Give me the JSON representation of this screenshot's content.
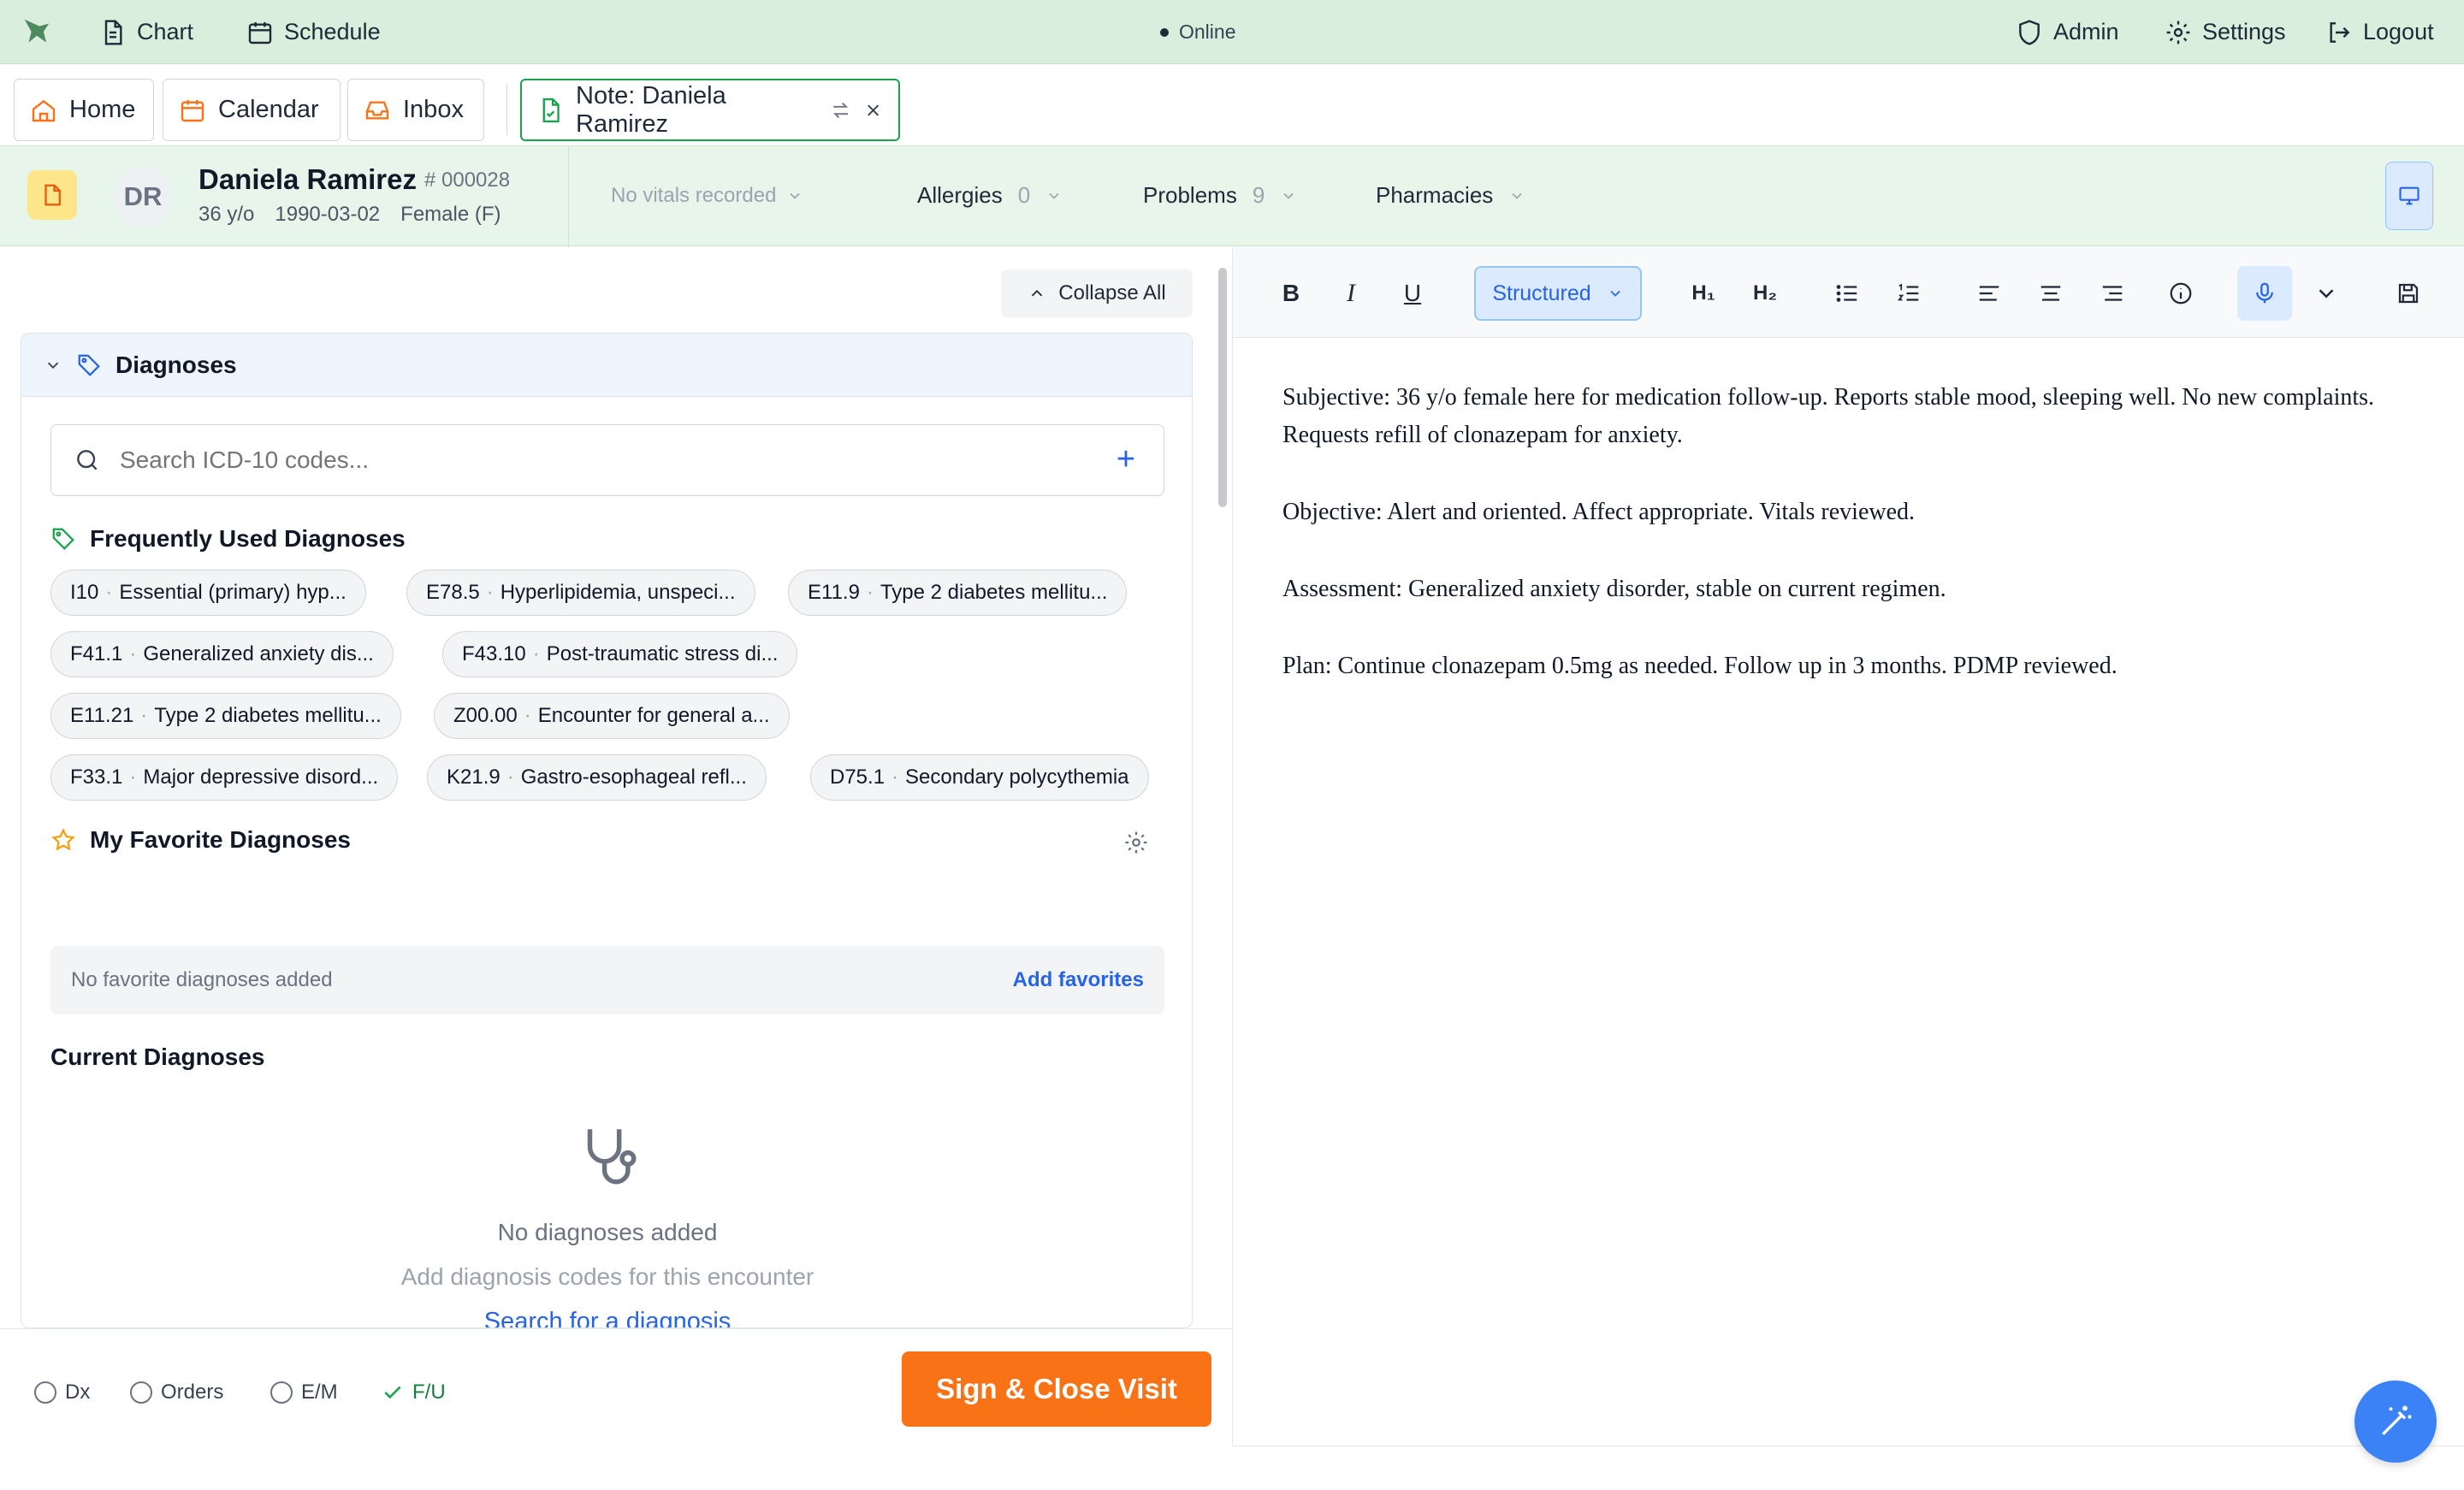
{
  "topbar": {
    "chart": "Chart",
    "schedule": "Schedule",
    "status": "Online",
    "admin": "Admin",
    "settings": "Settings",
    "logout": "Logout"
  },
  "tabs": [
    {
      "label": "Home",
      "icon": "home-icon"
    },
    {
      "label": "Calendar",
      "icon": "calendar-icon"
    },
    {
      "label": "Inbox",
      "icon": "inbox-icon"
    },
    {
      "label": "Note: Daniela Ramirez",
      "icon": "note-icon",
      "active": true
    }
  ],
  "patient": {
    "initials": "DR",
    "name": "Daniela Ramirez",
    "id": "# 000028",
    "age": "36 y/o",
    "dob": "1990-03-02",
    "sex": "Female (F)",
    "vitals": "No vitals recorded",
    "allergies_label": "Allergies",
    "allergies_count": "0",
    "problems_label": "Problems",
    "problems_count": "9",
    "pharmacies_label": "Pharmacies"
  },
  "left": {
    "collapse_all": "Collapse All",
    "section_title": "Diagnoses",
    "search_placeholder": "Search ICD-10 codes...",
    "frequent_title": "Frequently Used Diagnoses",
    "frequent": [
      {
        "code": "I10",
        "desc": "Essential (primary) hyp..."
      },
      {
        "code": "E78.5",
        "desc": "Hyperlipidemia, unspeci..."
      },
      {
        "code": "E11.9",
        "desc": "Type 2 diabetes mellitu..."
      },
      {
        "code": "F41.1",
        "desc": "Generalized anxiety dis..."
      },
      {
        "code": "F43.10",
        "desc": "Post-traumatic stress di..."
      },
      {
        "code": "E11.21",
        "desc": "Type 2 diabetes mellitu..."
      },
      {
        "code": "Z00.00",
        "desc": "Encounter for general a..."
      },
      {
        "code": "F33.1",
        "desc": "Major depressive disord..."
      },
      {
        "code": "K21.9",
        "desc": "Gastro-esophageal refl..."
      },
      {
        "code": "D75.1",
        "desc": "Secondary polycythemia"
      }
    ],
    "favorites_title": "My Favorite Diagnoses",
    "favorites_empty": "No favorite diagnoses added",
    "add_favorites": "Add favorites",
    "current_title": "Current Diagnoses",
    "empty_title": "No diagnoses added",
    "empty_sub": "Add diagnosis codes for this encounter",
    "empty_link": "Search for a diagnosis"
  },
  "bottom": {
    "dx": "Dx",
    "orders": "Orders",
    "em": "E/M",
    "fu": "F/U",
    "sign": "Sign & Close Visit"
  },
  "editor": {
    "bold": "B",
    "italic": "I",
    "underline": "U",
    "mode": "Structured",
    "h1": "H₁",
    "h2": "H₂",
    "paragraphs": [
      "Subjective: 36 y/o female here for medication follow-up. Reports stable mood, sleeping well. No new complaints. Requests refill of clonazepam for anxiety.",
      "Objective: Alert and oriented. Affect appropriate. Vitals reviewed.",
      "Assessment: Generalized anxiety disorder, stable on current regimen.",
      "Plan: Continue clonazepam 0.5mg as needed. Follow up in 3 months. PDMP reviewed."
    ]
  },
  "colors": {
    "topbar": "#d9eedd",
    "accent_green": "#16a34a",
    "primary_blue": "#2563eb",
    "sign_orange": "#f97316"
  }
}
